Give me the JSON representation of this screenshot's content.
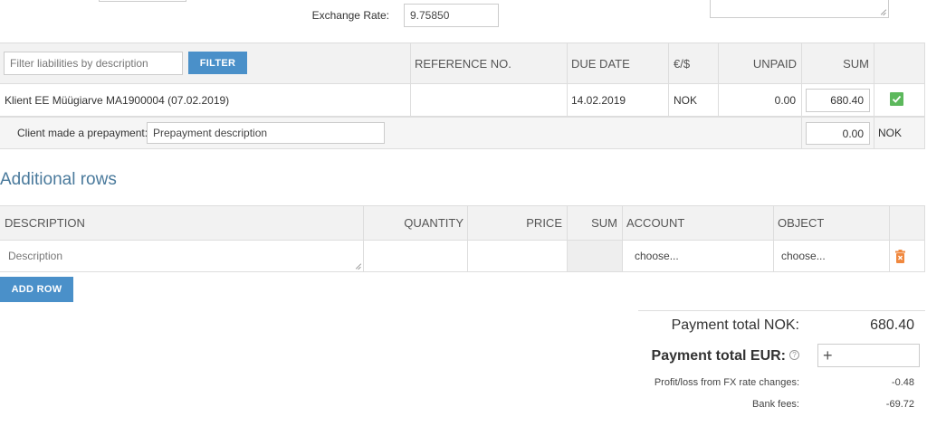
{
  "top": {
    "exchange_rate_label": "Exchange Rate:",
    "exchange_rate_value": "9.75850"
  },
  "liabilities": {
    "filter_placeholder": "Filter liabilities by description",
    "filter_button": "FILTER",
    "headers": {
      "reference": "REFERENCE NO.",
      "due_date": "DUE DATE",
      "currency": "€/$",
      "unpaid": "UNPAID",
      "sum": "SUM"
    },
    "row": {
      "description": "Klient EE Müügiarve MA1900004 (07.02.2019)",
      "due_date": "14.02.2019",
      "currency": "NOK",
      "unpaid": "0.00",
      "sum": "680.40"
    },
    "prepayment": {
      "label": "Client made a prepayment:",
      "description": "Prepayment description",
      "sum": "0.00",
      "currency": "NOK"
    }
  },
  "additional": {
    "title": "Additional rows",
    "headers": {
      "description": "DESCRIPTION",
      "quantity": "QUANTITY",
      "price": "PRICE",
      "sum": "SUM",
      "account": "ACCOUNT",
      "object": "OBJECT"
    },
    "row": {
      "description_placeholder": "Description",
      "account": "choose...",
      "object": "choose..."
    },
    "add_row_button": "ADD ROW"
  },
  "totals": {
    "payment_total_nok_label": "Payment total NOK:",
    "payment_total_nok_value": "680.40",
    "payment_total_eur_label": "Payment total EUR:",
    "payment_total_eur_input": "+",
    "fx_label": "Profit/loss from FX rate changes:",
    "fx_value": "-0.48",
    "bank_fees_label": "Bank fees:",
    "bank_fees_value": "-69.72"
  },
  "colors": {
    "accent": "#4a90c9",
    "check_green": "#5cb85c",
    "delete_orange": "#f0883e",
    "section_title": "#4a7a9c"
  }
}
